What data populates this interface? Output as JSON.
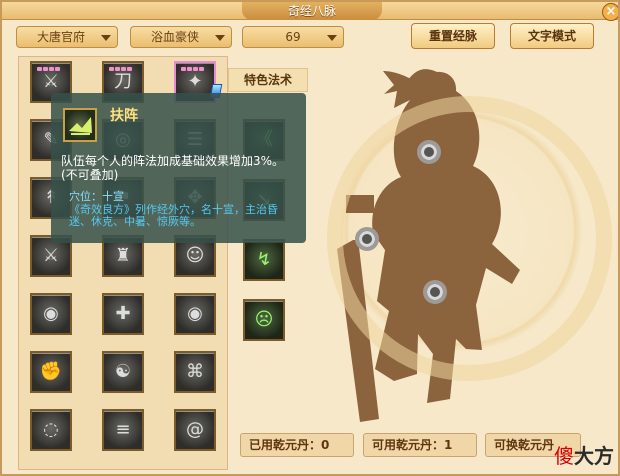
{
  "title": "奇经八脉",
  "close_label": "×",
  "dropdowns": [
    {
      "value": "大唐官府"
    },
    {
      "value": "浴血豪侠"
    },
    {
      "value": "69"
    }
  ],
  "buttons": {
    "reset": "重置经脉",
    "text_mode": "文字模式"
  },
  "section": {
    "special_spells": "特色法术"
  },
  "tooltip": {
    "name": "扶阵",
    "description": "队伍每个人的阵法加成基础效果增加3%。(不可叠加)",
    "point": "穴位：十宣",
    "detail": "《奇效良方》列作经外穴，名十宣，主治昏迷、休克、中暑、惊厥等。"
  },
  "skill_icons": [
    "sword-icon",
    "blade-strike-icon",
    "crystal-blade-icon",
    "scroll-icon",
    "wheel-icon",
    "bars-icon",
    "twin-arrows-icon",
    "flag-icon",
    "fan-icon",
    "battle-icon",
    "warrior-icon",
    "shield-face-icon",
    "spiral-icon",
    "strike-icon",
    "eye-icon",
    "fist-icon",
    "monk-icon",
    "horn-icon",
    "orb-icon",
    "banner-stack-icon",
    "swirl-icon"
  ],
  "special_icons": [
    "arrow-burst-icon",
    "strike-path-icon",
    "blade-flash-icon",
    "tiger-face-icon"
  ],
  "status": {
    "used": "已用乾元丹：0",
    "available": "可用乾元丹：1",
    "exchange": "可换乾元丹"
  },
  "watermark": {
    "red": "傻",
    "black": "大方"
  },
  "colors": {
    "panel": "#f6e8c8",
    "border": "#c79a5a",
    "tooltip": "#37524a",
    "accent": "#ffe17e"
  }
}
